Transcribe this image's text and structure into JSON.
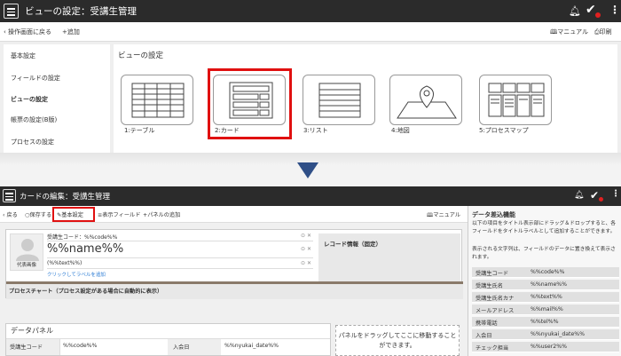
{
  "top": {
    "title": "ビューの設定：受講生管理",
    "back_label": "操作画面に戻る",
    "add_label": "追加",
    "manual_label": "マニュアル",
    "print_label": "印刷",
    "nav": [
      "基本設定",
      "フィールドの設定",
      "ビューの設定",
      "帳票の設定(Β版)",
      "プロセスの設定"
    ],
    "nav_active": "ビューの設定",
    "view_heading": "ビューの設定",
    "view_types": [
      {
        "label": "1:テーブル",
        "icon": "table-view-icon"
      },
      {
        "label": "2:カード",
        "icon": "card-view-icon"
      },
      {
        "label": "3:リスト",
        "icon": "list-view-icon"
      },
      {
        "label": "4:地図",
        "icon": "map-view-icon"
      },
      {
        "label": "5:プロセスマップ",
        "icon": "process-map-view-icon"
      }
    ],
    "highlighted": "2:カード"
  },
  "bottom": {
    "title": "カードの編集：受講生管理",
    "toolbar": {
      "back": "戻る",
      "save": "保存する",
      "basic_settings": "基本設定",
      "show_fields": "表示フィールド",
      "add_panel": "パネルの追加",
      "manual": "マニュアル"
    },
    "card": {
      "avatar_label": "代表画像",
      "code_field": "受講生コード：%%code%%",
      "name_field": "%%name%%",
      "text_field": "(%%text%%)",
      "add_label_link": "クリックしてラベルを追加",
      "record_info": "レコード情報（固定）",
      "process_chart": "プロセスチャート（プロセス設定がある場合に自動的に表示）"
    },
    "data_panel": {
      "title": "データパネル",
      "row_label_1": "受講生コード",
      "row_value_1": "%%code%%",
      "row_label_2": "入会日",
      "row_value_2": "%%nyukai_date%%"
    },
    "drop_zone": "パネルをドラッグしてここに移動することができます。",
    "side": {
      "heading": "データ差込機能",
      "desc1": "以下の項目をタイトル表示部にドラッグ＆ドロップすると、各フィールドをタイトルラベルとして追加することができます。",
      "desc2": "表示される文字列は、フィールドのデータに置き換えて表示されます。",
      "rows": [
        {
          "label": "受講生コード",
          "value": "%%code%%"
        },
        {
          "label": "受講生氏名",
          "value": "%%name%%"
        },
        {
          "label": "受講生氏名カナ",
          "value": "%%text%%"
        },
        {
          "label": "メールアドレス",
          "value": "%%mail%%"
        },
        {
          "label": "携帯電話",
          "value": "%%tel%%"
        },
        {
          "label": "入会日",
          "value": "%%nyukai_date%%"
        },
        {
          "label": "チェック担当",
          "value": "%%user2%%"
        }
      ]
    }
  },
  "colors": {
    "titlebar": "#2b2b2b",
    "highlight": "#e01010",
    "arrow": "#2f4f87"
  }
}
